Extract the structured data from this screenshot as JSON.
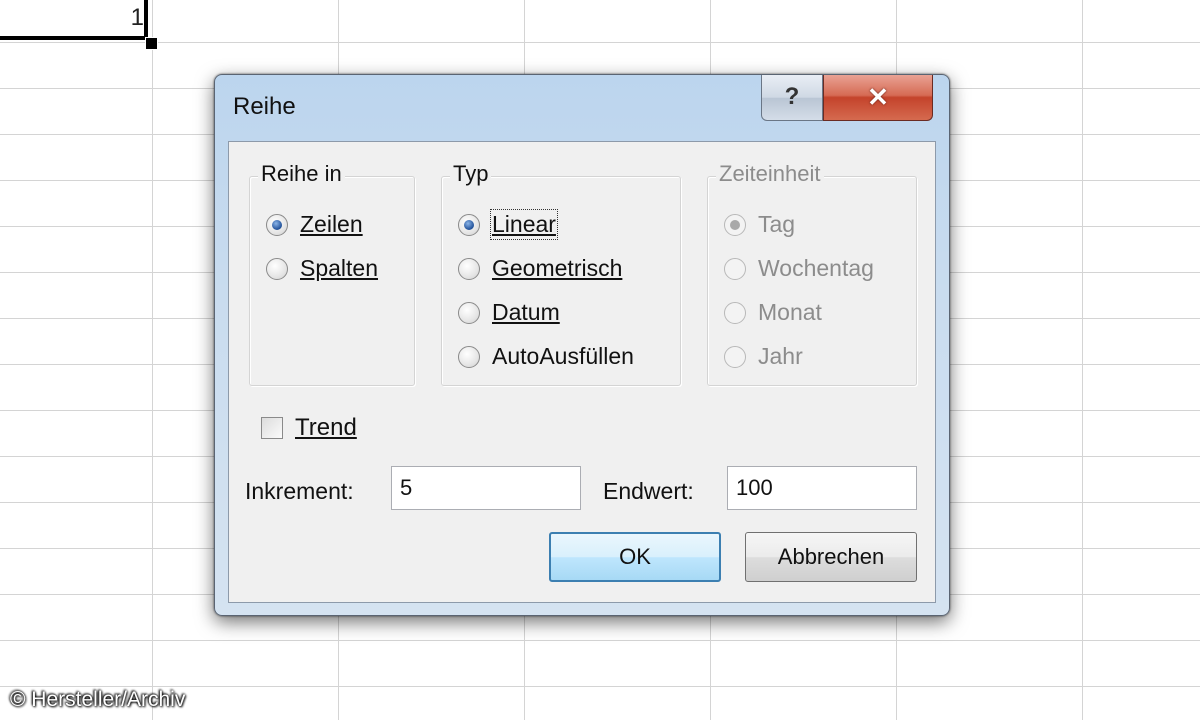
{
  "sheet": {
    "active_cell_value": "1"
  },
  "watermark": "© Hersteller/Archiv",
  "dialog": {
    "title": "Reihe",
    "help_glyph": "?",
    "close_glyph": "✕",
    "groups": {
      "reihe_in": {
        "legend": "Reihe in",
        "options": [
          {
            "label": "Zeilen",
            "checked": true
          },
          {
            "label": "Spalten",
            "checked": false
          }
        ]
      },
      "typ": {
        "legend": "Typ",
        "options": [
          {
            "label": "Linear",
            "checked": true
          },
          {
            "label": "Geometrisch",
            "checked": false
          },
          {
            "label": "Datum",
            "checked": false
          },
          {
            "label": "AutoAusfüllen",
            "checked": false
          }
        ]
      },
      "zeiteinheit": {
        "legend": "Zeiteinheit",
        "enabled": false,
        "options": [
          {
            "label": "Tag",
            "checked": true
          },
          {
            "label": "Wochentag",
            "checked": false
          },
          {
            "label": "Monat",
            "checked": false
          },
          {
            "label": "Jahr",
            "checked": false
          }
        ]
      }
    },
    "trend": {
      "label": "Trend",
      "checked": false
    },
    "inkrement": {
      "label": "Inkrement:",
      "value": "5"
    },
    "endwert": {
      "label": "Endwert:",
      "value": "100"
    },
    "ok_label": "OK",
    "cancel_label": "Abbrechen"
  },
  "colors": {
    "title_gradient": "#c9dcef",
    "close_button": "#c4432b",
    "default_button_border": "#3c7fb1",
    "disabled_text": "#8c8c8c"
  }
}
